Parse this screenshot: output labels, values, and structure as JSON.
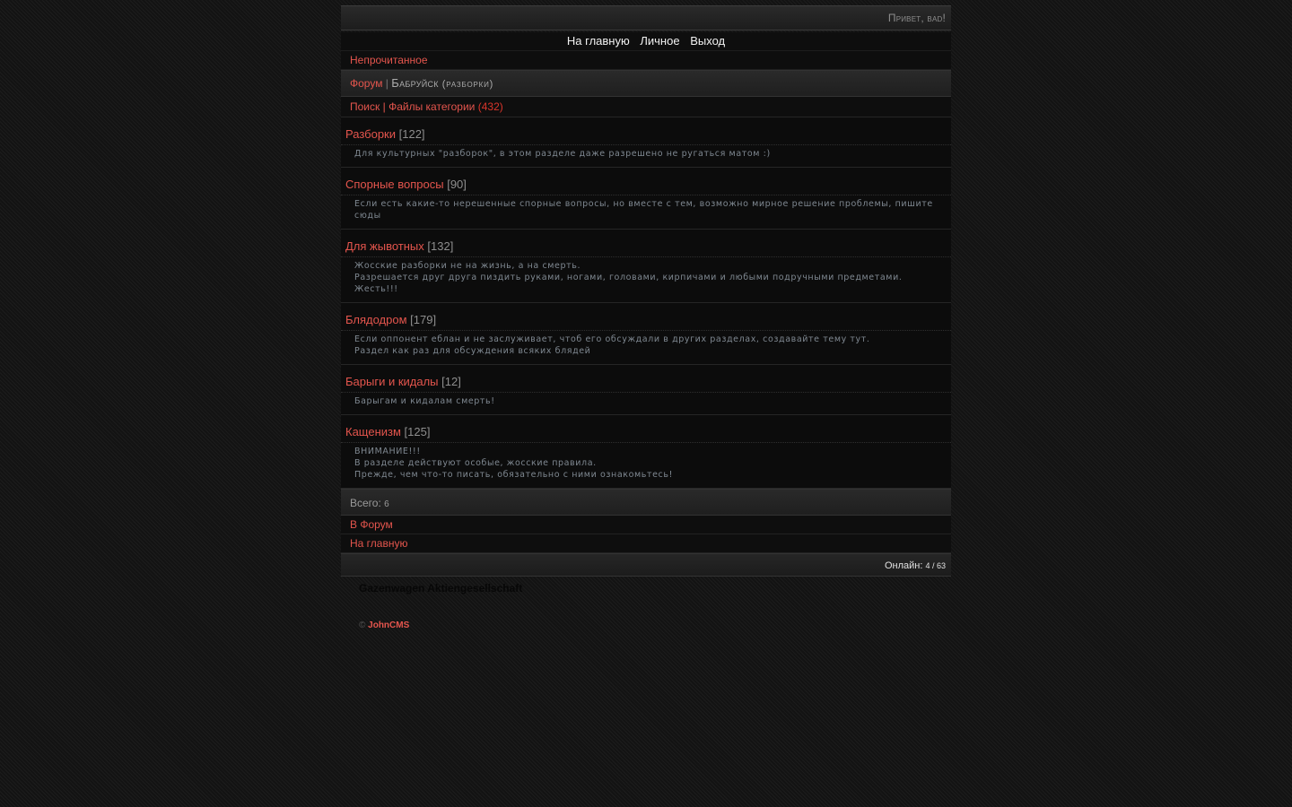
{
  "topbar": {
    "greeting": "Привет, bad!"
  },
  "nav": {
    "items": [
      {
        "label": "На главную"
      },
      {
        "label": "Личное"
      },
      {
        "label": "Выход"
      }
    ]
  },
  "unread": {
    "label": "Непрочитанное"
  },
  "header": {
    "forum_link": "Форум",
    "separator": "|",
    "category": "Бабруйск",
    "category_sub": "(разборки)"
  },
  "tools": {
    "search": "Поиск",
    "separator": "|",
    "files": "Файлы категории",
    "files_count": "(432)"
  },
  "sections": [
    {
      "title": "Разборки",
      "count": "[122]",
      "desc": [
        "Для культурных \"разборок\", в этом разделе даже разрешено не ругаться матом :)"
      ]
    },
    {
      "title": "Спорные вопросы",
      "count": "[90]",
      "desc": [
        "Если есть какие-то нерешенные спорные вопросы, но вместе с тем, возможно мирное решение проблемы, пишите сюды"
      ]
    },
    {
      "title": "Для жывотных",
      "count": "[132]",
      "desc": [
        "Жосские разборки не на жизнь, а на смерть.",
        "Разрешается друг друга пиздить руками, ногами, головами, кирпичами и любыми подручными предметами.",
        "Жесть!!!"
      ]
    },
    {
      "title": "Блядодром",
      "count": "[179]",
      "desc": [
        "Если оппонент еблан и не заслуживает, чтоб его обсуждали в других разделах, создавайте тему тут.",
        "Раздел как раз для обсуждения всяких блядей"
      ]
    },
    {
      "title": "Барыги и кидалы",
      "count": "[12]",
      "desc": [
        "Барыгам и кидалам смерть!"
      ]
    },
    {
      "title": "Кащенизм",
      "count": "[125]",
      "desc": [
        "ВНИМАНИЕ!!!",
        "В разделе действуют особые, жосские правила.",
        "Прежде, чем что-то писать, обязательно с ними ознакомьтесь!"
      ]
    }
  ],
  "total": {
    "label": "Всего:",
    "value": "6"
  },
  "links": {
    "forum": "В Форум",
    "home": "На главную"
  },
  "footer": {
    "online_label": "Онлайн:",
    "online_value": "4 / 63"
  },
  "brand": {
    "text": "Gazenwagen Aktiengesellschaft"
  },
  "copyright": {
    "symbol": "©",
    "engine": "JohnCMS"
  }
}
